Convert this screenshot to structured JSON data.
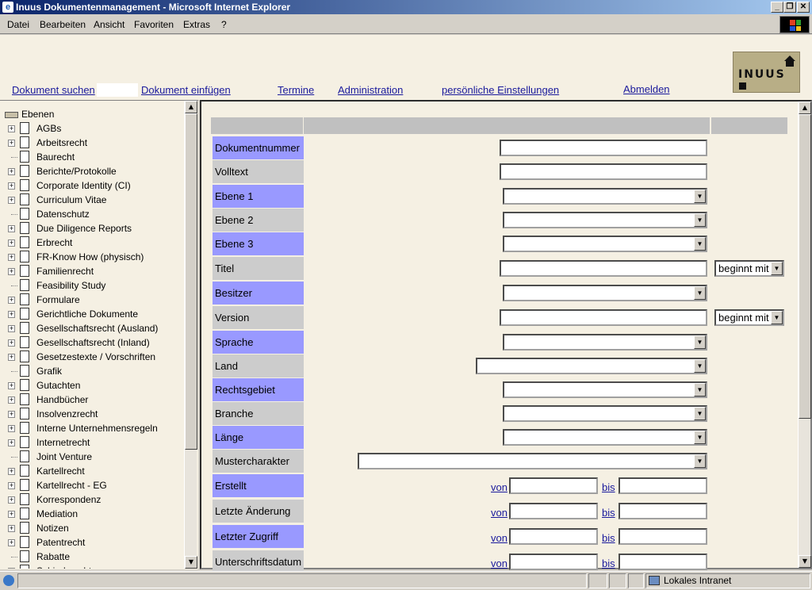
{
  "window": {
    "title": "Inuus Dokumentenmanagement - Microsoft Internet Explorer",
    "ie_icon": "e",
    "controls": [
      "_",
      "❐",
      "✕"
    ]
  },
  "menu": [
    "Datei",
    "Bearbeiten",
    "Ansicht",
    "Favoriten",
    "Extras",
    "?"
  ],
  "nav": {
    "search": "Dokument suchen",
    "insert": "Dokument einfügen",
    "dates": "Termine",
    "admin": "Administration",
    "settings": "persönliche Einstellungen",
    "logout": "Abmelden"
  },
  "logo": {
    "text": "INUUS"
  },
  "tree": {
    "root": "Ebenen",
    "items": [
      {
        "label": "AGBs",
        "expandable": true
      },
      {
        "label": "Arbeitsrecht",
        "expandable": true
      },
      {
        "label": "Baurecht",
        "expandable": false
      },
      {
        "label": "Berichte/Protokolle",
        "expandable": true
      },
      {
        "label": "Corporate Identity (CI)",
        "expandable": true
      },
      {
        "label": "Curriculum Vitae",
        "expandable": true
      },
      {
        "label": "Datenschutz",
        "expandable": false
      },
      {
        "label": "Due Diligence Reports",
        "expandable": true
      },
      {
        "label": "Erbrecht",
        "expandable": true
      },
      {
        "label": "FR-Know How (physisch)",
        "expandable": true
      },
      {
        "label": "Familienrecht",
        "expandable": true
      },
      {
        "label": "Feasibility Study",
        "expandable": false
      },
      {
        "label": "Formulare",
        "expandable": true
      },
      {
        "label": "Gerichtliche Dokumente",
        "expandable": true
      },
      {
        "label": "Gesellschaftsrecht (Ausland)",
        "expandable": true
      },
      {
        "label": "Gesellschaftsrecht (Inland)",
        "expandable": true
      },
      {
        "label": "Gesetzestexte / Vorschriften",
        "expandable": true
      },
      {
        "label": "Grafik",
        "expandable": false
      },
      {
        "label": "Gutachten",
        "expandable": true
      },
      {
        "label": "Handbücher",
        "expandable": true
      },
      {
        "label": "Insolvenzrecht",
        "expandable": true
      },
      {
        "label": "Interne Unternehmensregeln",
        "expandable": true
      },
      {
        "label": "Internetrecht",
        "expandable": true
      },
      {
        "label": "Joint Venture",
        "expandable": false
      },
      {
        "label": "Kartellrecht",
        "expandable": true
      },
      {
        "label": "Kartellrecht - EG",
        "expandable": true
      },
      {
        "label": "Korrespondenz",
        "expandable": true
      },
      {
        "label": "Mediation",
        "expandable": true
      },
      {
        "label": "Notizen",
        "expandable": true
      },
      {
        "label": "Patentrecht",
        "expandable": true
      },
      {
        "label": "Rabatte",
        "expandable": false
      },
      {
        "label": "Schiedsrecht",
        "expandable": true
      }
    ]
  },
  "form": {
    "fields": [
      {
        "label": "Dokumentnummer",
        "type": "text"
      },
      {
        "label": "Volltext",
        "type": "text"
      },
      {
        "label": "Ebene 1",
        "type": "select"
      },
      {
        "label": "Ebene 2",
        "type": "select"
      },
      {
        "label": "Ebene 3",
        "type": "select"
      },
      {
        "label": "Titel",
        "type": "text-op"
      },
      {
        "label": "Besitzer",
        "type": "select"
      },
      {
        "label": "Version",
        "type": "text-op"
      },
      {
        "label": "Sprache",
        "type": "select"
      },
      {
        "label": "Land",
        "type": "select"
      },
      {
        "label": "Rechtsgebiet",
        "type": "select"
      },
      {
        "label": "Branche",
        "type": "select"
      },
      {
        "label": "Länge",
        "type": "select"
      },
      {
        "label": "Mustercharakter",
        "type": "select"
      },
      {
        "label": "Erstellt",
        "type": "range"
      },
      {
        "label": "Letzte Änderung",
        "type": "range"
      },
      {
        "label": "Letzter Zugriff",
        "type": "range"
      },
      {
        "label": "Unterschriftsdatum",
        "type": "range"
      }
    ],
    "operator_value": "beginnt mit",
    "range_from": "von",
    "range_to": "bis"
  },
  "status": {
    "zone": "Lokales Intranet",
    "zone_icon": "intranet-icon"
  }
}
